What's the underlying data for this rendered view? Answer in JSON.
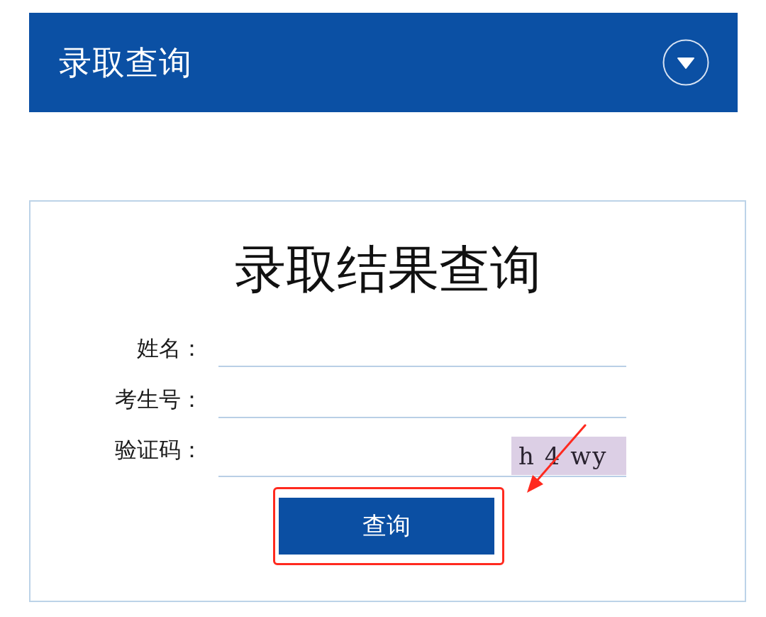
{
  "header": {
    "title": "录取查询",
    "menu": {
      "expanded": false
    }
  },
  "card": {
    "title": "录取结果查询",
    "fields": [
      {
        "kind": "text",
        "label": "姓名："
      },
      {
        "kind": "text",
        "label": "考生号："
      },
      {
        "kind": "captcha",
        "label": "验证码：",
        "captcha": "h 4 wy"
      }
    ],
    "submit": "查询"
  },
  "annotation": {
    "highlight_submit": true,
    "arrow": true
  }
}
